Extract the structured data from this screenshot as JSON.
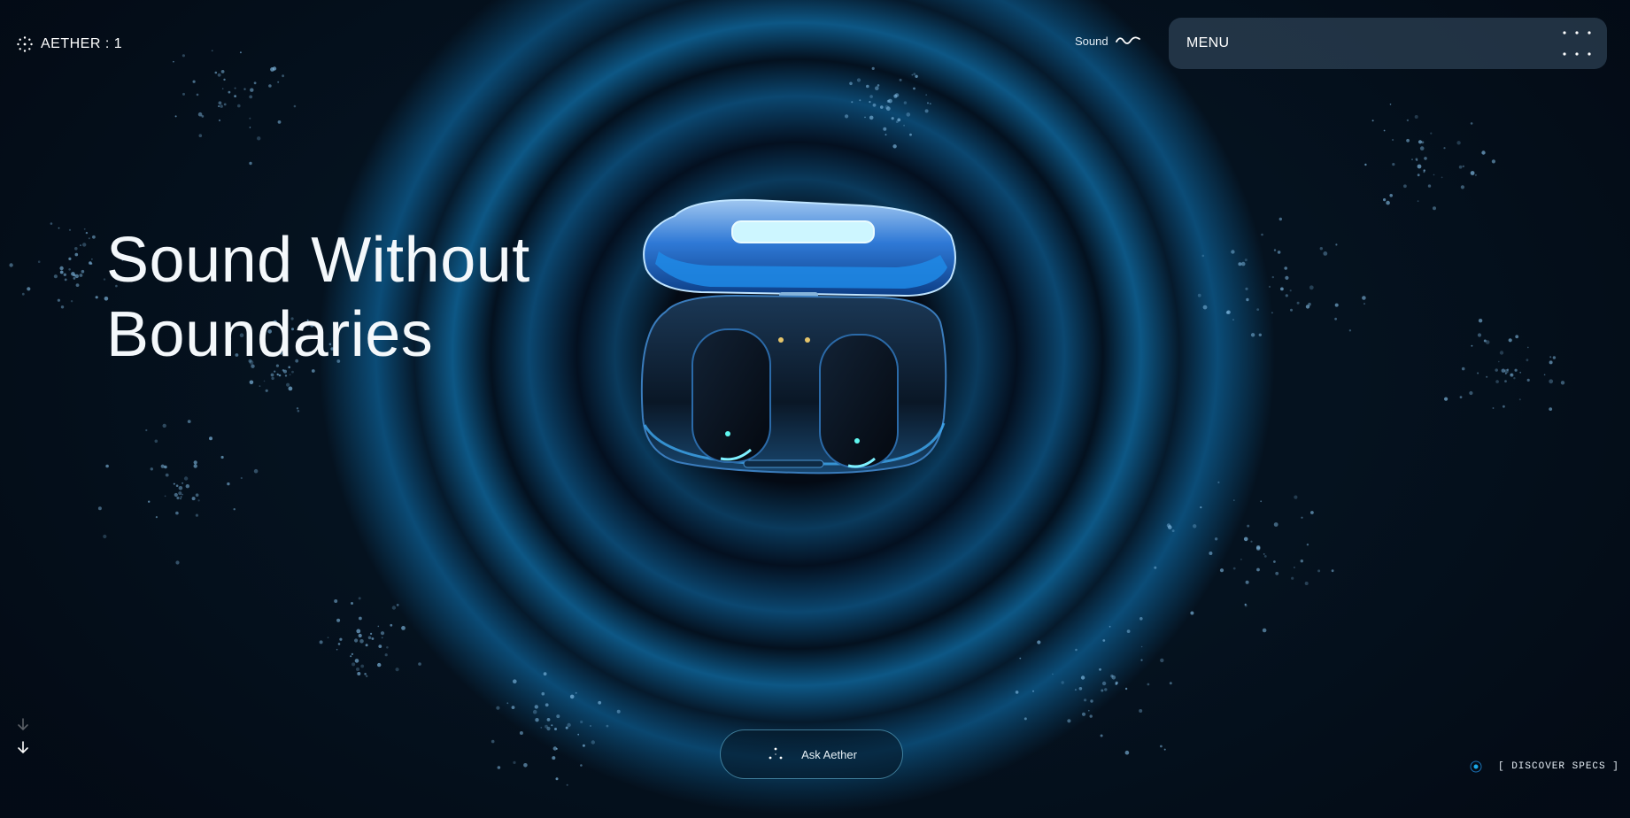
{
  "header": {
    "logo_icon": "dotted-circle-icon",
    "brand": "AETHER : 1",
    "sound_label": "Sound",
    "sound_icon": "wave-icon",
    "menu_label": "MENU",
    "menu_icon": "grid-dots-icon"
  },
  "hero": {
    "title_line1": "Sound Without",
    "title_line2": "Boundaries",
    "image": "earbuds-charging-case"
  },
  "footer": {
    "scroll_icon": "arrow-down-icon",
    "ask_icon": "sparkle-dots-icon",
    "ask_label": "Ask Aether",
    "discover_label": "[ DISCOVER SPECS ]"
  },
  "colors": {
    "background": "#05101c",
    "accent": "#1aa8e8",
    "menu_bg": "#3a5268"
  }
}
